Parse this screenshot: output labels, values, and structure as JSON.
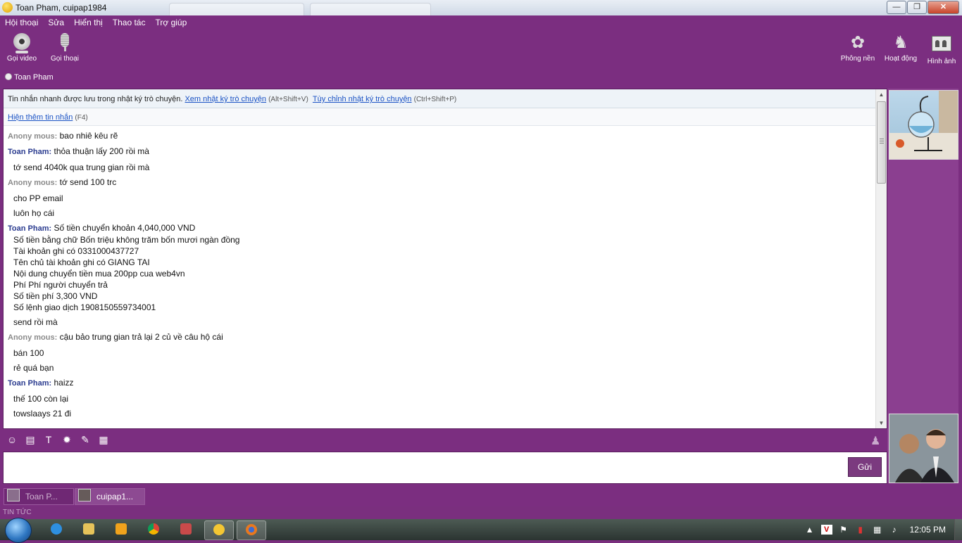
{
  "window": {
    "title": "Toan Pham, cuipap1984"
  },
  "menu": [
    "Hội thoại",
    "Sửa",
    "Hiển thị",
    "Thao tác",
    "Trợ giúp"
  ],
  "toolbar": {
    "video_call": "Gọi video",
    "voice_call": "Gọi thoại",
    "background": "Phông nền",
    "activities": "Hoạt động",
    "pictures": "Hình ảnh"
  },
  "contact": {
    "name": "Toan Pham"
  },
  "notice": {
    "text": "Tin nhắn nhanh được lưu trong nhật ký trò chuyện.",
    "view_link": "Xem nhật ký trò chuyện",
    "view_shortcut": "(Alt+Shift+V)",
    "customize_link": "Tùy chỉnh nhật ký trò chuyện",
    "customize_shortcut": "(Ctrl+Shift+P)"
  },
  "more": {
    "link": "Hiện thêm tin nhắn",
    "shortcut": "(F4)"
  },
  "messages": {
    "m1": {
      "sender": "Anony mous:",
      "lines": [
        "bao nhiê kêu rẽ"
      ]
    },
    "m2": {
      "sender": "Toan Pham:",
      "lines": [
        "thỏa thuận lấy 200 rồi mà",
        "tớ send 4040k qua trung gian rồi mà"
      ]
    },
    "m3": {
      "sender": "Anony mous:",
      "lines": [
        "tớ send 100 trc",
        "cho PP email",
        "luôn họ cái"
      ]
    },
    "m4": {
      "sender": "Toan Pham:",
      "lines": [
        "Số tiền chuyển khoản 4,040,000 VND",
        "Số tiền bằng chữ Bốn triệu không trăm bốn mươi ngàn đồng",
        "Tài khoản ghi có 0331000437727",
        "Tên chủ tài khoản ghi có GIANG TAI",
        "Nội dung chuyển tiền mua 200pp cua web4vn",
        "Phí Phí người chuyển trả",
        "Số tiền phí 3,300 VND",
        "Số lệnh giao dịch 1908150559734001",
        "send rồi mà"
      ]
    },
    "m5": {
      "sender": "Anony mous:",
      "lines": [
        "cậu bảo trung gian trả lại 2 củ về câu hộ cái",
        "bán 100",
        "rẻ quá bạn"
      ]
    },
    "m6": {
      "sender": "Toan Pham:",
      "lines": [
        "haizz",
        "thế 100 còn lại",
        "towslaays 21 đi"
      ]
    }
  },
  "input": {
    "value": "",
    "send_label": "Gửi"
  },
  "tabs": [
    "Toan P...",
    "cuipap1..."
  ],
  "news_label": "TIN TỨC",
  "taskbar": {
    "clock": "12:05 PM"
  }
}
